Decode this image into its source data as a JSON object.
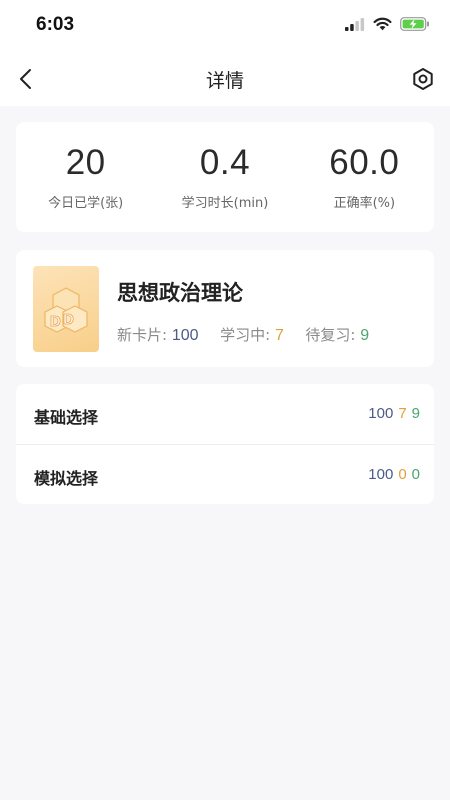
{
  "status_bar": {
    "time": "6:03"
  },
  "nav": {
    "title": "详情"
  },
  "stats": [
    {
      "value": "20",
      "label": "今日已学(张)"
    },
    {
      "value": "0.4",
      "label": "学习时长(min)"
    },
    {
      "value": "60.0",
      "label": "正确率(%)"
    }
  ],
  "deck": {
    "title": "思想政治理论",
    "new_label": "新卡片:",
    "new_count": "100",
    "learning_label": "学习中:",
    "learning_count": "7",
    "review_label": "待复习:",
    "review_count": "9"
  },
  "sections": [
    {
      "label": "基础选择",
      "new": "100",
      "learning": "7",
      "review": "9"
    },
    {
      "label": "模拟选择",
      "new": "100",
      "learning": "0",
      "review": "0"
    }
  ],
  "colors": {
    "new": "#4b5a8a",
    "learning": "#e0a13a",
    "review": "#4aa66e",
    "battery": "#5fce4a"
  },
  "icons": {
    "signal": "signal-icon",
    "wifi": "wifi-icon",
    "battery": "battery-charging-icon",
    "back": "chevron-left-icon",
    "settings": "hexagon-settings-icon",
    "deck_logo": "deck-logo-icon"
  }
}
